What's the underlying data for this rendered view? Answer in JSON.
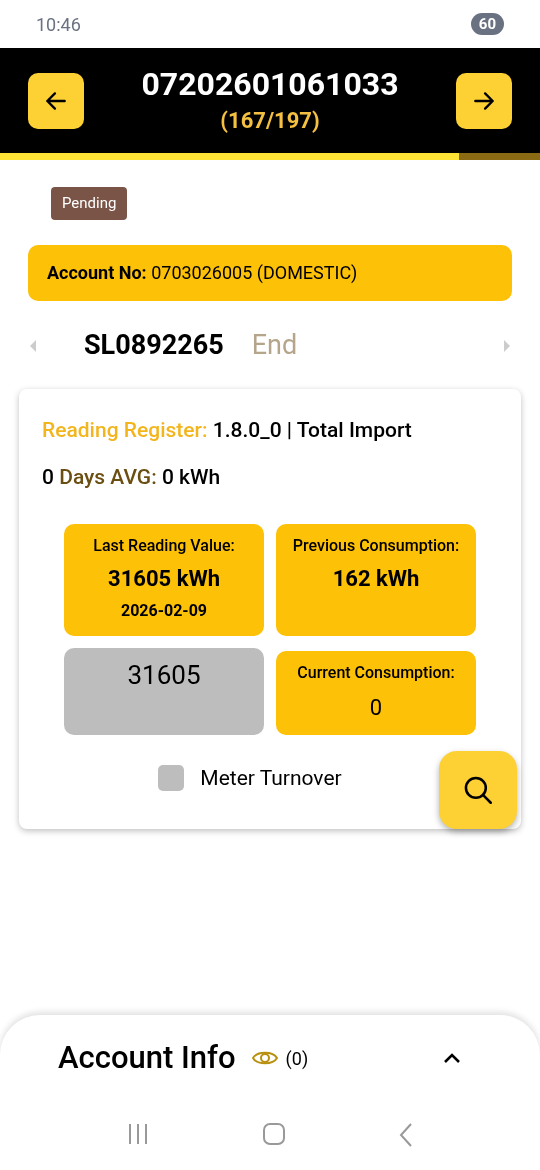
{
  "status_bar": {
    "time": "10:46",
    "battery": "60"
  },
  "header": {
    "title": "07202601061033",
    "counter": "(167/197)"
  },
  "progress": {
    "level": 0.85
  },
  "status_badge": "Pending",
  "account": {
    "label": "Account No:",
    "value": "0703026005 (DOMESTIC)"
  },
  "meter": {
    "serial": "SL0892265",
    "position": "End"
  },
  "reading_card": {
    "register_label": "Reading Register:",
    "register_value": "1.8.0_0 | Total Import",
    "avg_days": "0",
    "avg_label": "Days AVG:",
    "avg_value": "0 kWh",
    "tiles": [
      {
        "kind": "info",
        "label": "Last Reading Value:",
        "value": "31605 kWh",
        "date": "2026-02-09"
      },
      {
        "kind": "info",
        "label": "Previous Consumption:",
        "value": "162 kWh"
      },
      {
        "kind": "input",
        "value": "31605"
      },
      {
        "kind": "result",
        "label": "Current Consumption:",
        "value": "0"
      }
    ],
    "meter_turnover": {
      "label": "Meter Turnover",
      "checked": false
    }
  },
  "account_info": {
    "title": "Account Info",
    "count": "(0)",
    "expanded": false
  }
}
